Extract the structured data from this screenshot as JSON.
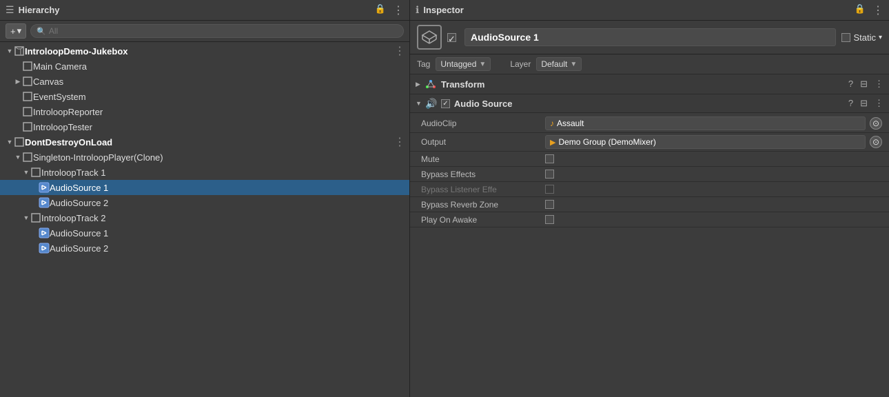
{
  "hierarchy": {
    "panel_title": "Hierarchy",
    "add_button": "+",
    "add_arrow": "▾",
    "search_placeholder": "All",
    "lock_icon": "🔒",
    "kebab_icon": "⋮",
    "items": [
      {
        "id": "introloop-demo",
        "label": "IntroloopDemo-Jukebox",
        "level": 0,
        "expanded": true,
        "has_arrow": true,
        "bold": true,
        "show_kebab": true
      },
      {
        "id": "main-camera",
        "label": "Main Camera",
        "level": 1,
        "expanded": false,
        "has_arrow": false
      },
      {
        "id": "canvas",
        "label": "Canvas",
        "level": 1,
        "expanded": false,
        "has_arrow": true
      },
      {
        "id": "event-system",
        "label": "EventSystem",
        "level": 1,
        "expanded": false,
        "has_arrow": false
      },
      {
        "id": "introloop-reporter",
        "label": "IntroloopReporter",
        "level": 1,
        "expanded": false,
        "has_arrow": false
      },
      {
        "id": "introloop-tester",
        "label": "IntroloopTester",
        "level": 1,
        "expanded": false,
        "has_arrow": false
      },
      {
        "id": "dont-destroy",
        "label": "DontDestroyOnLoad",
        "level": 0,
        "expanded": true,
        "has_arrow": true,
        "bold": true,
        "show_kebab": true
      },
      {
        "id": "singleton",
        "label": "Singleton-IntroloopPlayer(Clone)",
        "level": 1,
        "expanded": true,
        "has_arrow": true
      },
      {
        "id": "introloop-track-1",
        "label": "IntroloopTrack 1",
        "level": 2,
        "expanded": true,
        "has_arrow": true
      },
      {
        "id": "audio-source-1",
        "label": "AudioSource 1",
        "level": 3,
        "expanded": false,
        "has_arrow": false,
        "selected": true
      },
      {
        "id": "audio-source-2a",
        "label": "AudioSource 2",
        "level": 3,
        "expanded": false,
        "has_arrow": false
      },
      {
        "id": "introloop-track-2",
        "label": "IntroloopTrack 2",
        "level": 2,
        "expanded": true,
        "has_arrow": true
      },
      {
        "id": "audio-source-1b",
        "label": "AudioSource 1",
        "level": 3,
        "expanded": false,
        "has_arrow": false
      },
      {
        "id": "audio-source-2b",
        "label": "AudioSource 2",
        "level": 3,
        "expanded": false,
        "has_arrow": false
      }
    ]
  },
  "inspector": {
    "panel_title": "Inspector",
    "lock_icon": "🔒",
    "kebab_icon": "⋮",
    "go_name": "AudioSource 1",
    "static_label": "Static",
    "static_arrow": "▾",
    "tag_label": "Tag",
    "tag_value": "Untagged",
    "layer_label": "Layer",
    "layer_value": "Default",
    "transform": {
      "title": "Transform",
      "collapsed": true
    },
    "audio_source": {
      "title": "Audio Source",
      "enabled": true,
      "properties": [
        {
          "label": "AudioClip",
          "value": "Assault",
          "type": "asset",
          "icon": "music",
          "has_circle": true,
          "dimmed": false
        },
        {
          "label": "Output",
          "value": "Demo Group (DemoMixer)",
          "type": "asset",
          "icon": "group",
          "has_circle": true,
          "dimmed": false
        },
        {
          "label": "Mute",
          "value": "",
          "type": "checkbox",
          "dimmed": false
        },
        {
          "label": "Bypass Effects",
          "value": "",
          "type": "checkbox",
          "dimmed": false
        },
        {
          "label": "Bypass Listener Effe",
          "value": "",
          "type": "checkbox",
          "dimmed": true
        },
        {
          "label": "Bypass Reverb Zone",
          "value": "",
          "type": "checkbox",
          "dimmed": false
        },
        {
          "label": "Play On Awake",
          "value": "",
          "type": "checkbox",
          "dimmed": false
        }
      ]
    }
  }
}
